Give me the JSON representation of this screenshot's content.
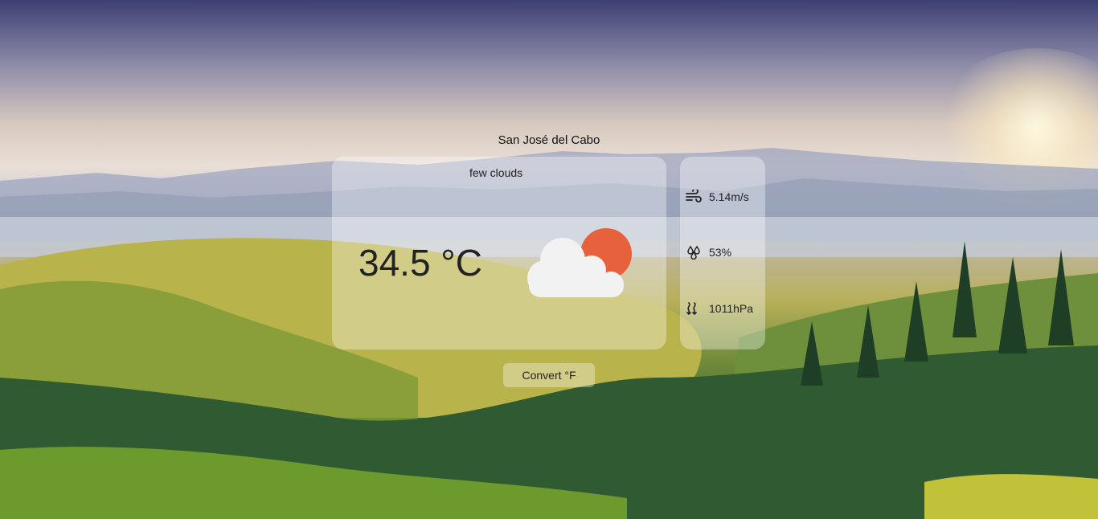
{
  "location": {
    "city": "San José del Cabo"
  },
  "weather": {
    "description": "few clouds",
    "temperature": "34.5 °C",
    "icon": "partly-cloudy-sun-icon"
  },
  "stats": {
    "wind": {
      "icon": "wind-icon",
      "value": "5.14m/s"
    },
    "humidity": {
      "icon": "humidity-icon",
      "value": "53%"
    },
    "pressure": {
      "icon": "pressure-icon",
      "value": "1011hPa"
    }
  },
  "actions": {
    "convert_label": "Convert °F"
  },
  "colors": {
    "sun": "#e8613d",
    "cloud": "#f2f2f2",
    "card": "rgba(255,255,255,0.35)",
    "text": "#222222"
  }
}
